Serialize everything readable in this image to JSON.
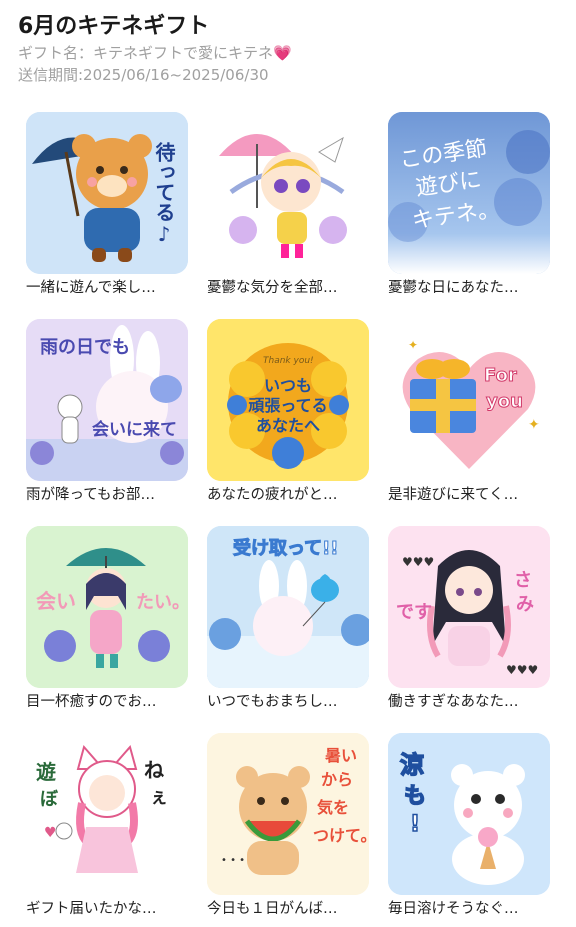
{
  "header": {
    "title": "6月のキテネギフト",
    "gift_name": "ギフト名：キテネギフトで愛にキテネ",
    "heart_icon": "💗",
    "period": "送信期間:2025/06/16~2025/06/30"
  },
  "items": [
    {
      "caption": "一緒に遊んで楽し…",
      "bg": "#cfe4f8",
      "icon": "bear-umbrella-icon",
      "text": "待ってる♪"
    },
    {
      "caption": "憂鬱な気分を全部…",
      "bg": "#ffffff",
      "icon": "girl-umbrella-icon",
      "text": ""
    },
    {
      "caption": "憂鬱な日にあなた…",
      "bg": "#8fb5e6",
      "icon": "hydrangea-icon",
      "text": "この季節 遊びに キテネ。"
    },
    {
      "caption": "雨が降ってもお部…",
      "bg": "#e6dcf6",
      "icon": "bunny-rain-icon",
      "text": "雨の日でも 会いに来て"
    },
    {
      "caption": "あなたの疲れがと…",
      "bg": "#ffe56a",
      "icon": "flowers-icon",
      "text": "いつも 頑張ってる あなたへ"
    },
    {
      "caption": "是非遊びに来てく…",
      "bg": "#ffffff",
      "icon": "gift-heart-icon",
      "text": "For you"
    },
    {
      "caption": "目一杯癒すのでお…",
      "bg": "#d9f3d0",
      "icon": "girl-green-umbrella-icon",
      "text": "会いたい。"
    },
    {
      "caption": "いつでもおまちし…",
      "bg": "#cfe6f8",
      "icon": "bunny-balloon-icon",
      "text": "受け取って!!"
    },
    {
      "caption": "働きすぎなあなた…",
      "bg": "#fde2f0",
      "icon": "girl-dark-hair-icon",
      "text": "ですか？ さみしい"
    },
    {
      "caption": "ギフト届いたかな…",
      "bg": "#ffffff",
      "icon": "cat-hood-girl-icon",
      "text": "遊ぼ ねぇ"
    },
    {
      "caption": "今日も１日がんば…",
      "bg": "#fdf5e0",
      "icon": "bear-watermelon-icon",
      "text": "暑いから 気をつけて。"
    },
    {
      "caption": "毎日溶けそうなぐ…",
      "bg": "#cfe6fb",
      "icon": "polar-bear-icecream-icon",
      "text": "涼も!"
    }
  ]
}
